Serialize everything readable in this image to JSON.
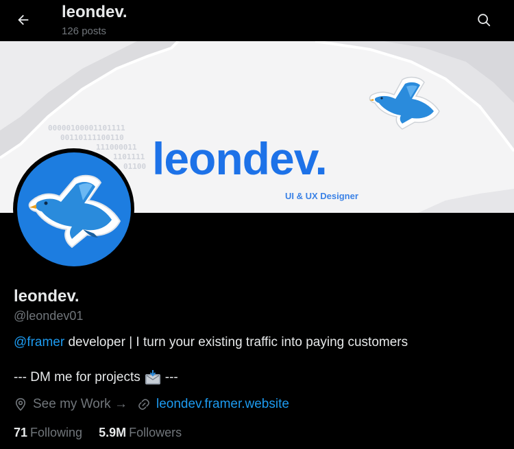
{
  "header": {
    "title": "leondev.",
    "posts_count": "126 posts"
  },
  "banner": {
    "title": "leondev.",
    "subtitle": "UI & UX Designer",
    "binary_lines": [
      "00000100001101111",
      "00110111100110",
      "111000011",
      "1101111",
      "01100"
    ]
  },
  "profile": {
    "name": "leondev.",
    "handle": "@leondev01"
  },
  "bio": {
    "mention": "@framer",
    "text": " developer | I turn your existing traffic into paying customers",
    "line2_prefix": "--- DM me for projects",
    "line2_suffix": "---"
  },
  "meta": {
    "location": "See my Work →",
    "website": "leondev.framer.website"
  },
  "stats": {
    "following_count": "71",
    "following_label": "Following",
    "followers_count": "5.9M",
    "followers_label": "Followers"
  },
  "colors": {
    "accent_link": "#1d9bf0",
    "brand_blue": "#1d72e8",
    "muted": "#71767b",
    "text": "#e7e9ea",
    "background": "#000000"
  },
  "icons": {
    "back": "arrow-left-icon",
    "search": "search-icon",
    "location": "location-pin-icon",
    "link": "link-icon",
    "mailbox": "mailbox-icon"
  }
}
